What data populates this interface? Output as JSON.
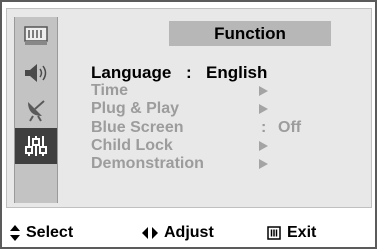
{
  "menu": {
    "title": "Function",
    "language_label": "Language",
    "language_sep": ":",
    "language_value": "English",
    "items": [
      {
        "label": "Time"
      },
      {
        "label": "Plug & Play"
      },
      {
        "label": "Blue Screen",
        "sep": ":",
        "value": "Off"
      },
      {
        "label": "Child Lock"
      },
      {
        "label": "Demonstration"
      }
    ]
  },
  "icons": [
    "input-icon",
    "sound-icon",
    "channel-antenna-icon",
    "function-sliders-icon"
  ],
  "footer": {
    "select_label": "Select",
    "adjust_label": "Adjust",
    "exit_label": "Exit"
  },
  "colors": {
    "title_bar": "#b7b7b7",
    "selected_icon": "#3f3f3f",
    "dim_text": "#9c9c9c",
    "active_text": "#000000"
  }
}
